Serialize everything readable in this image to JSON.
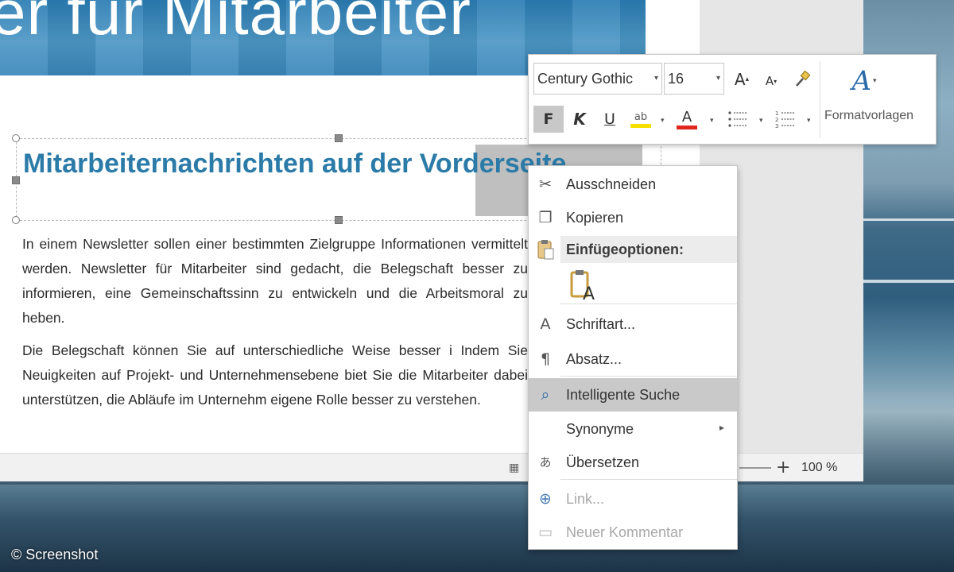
{
  "document": {
    "banner_text": "er für Mitarbeiter",
    "heading": "Mitarbeiternachrichten auf der Vorderseite",
    "paragraphs": [
      "In einem Newsletter sollen einer bestimmten Zielgruppe Informationen vermittelt werden. Newsletter für Mitarbeiter sind gedacht, die Belegschaft besser zu informieren, eine Gemeinschaftssinn zu entwickeln und die Arbeitsmoral zu heben.",
      "Die Belegschaft können Sie auf unterschiedliche Weise besser i Indem Sie Neuigkeiten auf Projekt- und Unternehmensebene biet Sie die Mitarbeiter dabei unterstützen, die Abläufe im Unternehm eigene Rolle besser zu verstehen."
    ]
  },
  "status_bar": {
    "zoom_plus": "+",
    "zoom_level": "100 %"
  },
  "mini_toolbar": {
    "font_name": "Century Gothic",
    "font_size": "16",
    "grow_font": "A",
    "shrink_font": "A",
    "bold": "F",
    "italic": "K",
    "underline": "U",
    "highlight_glyph": "ab",
    "font_color_glyph": "A",
    "styles_label": "Formatvorlagen",
    "styles_glyph": "A"
  },
  "context_menu": {
    "paste_options_header": "Einfügeoptionen:",
    "items": [
      {
        "label": "Ausschneiden",
        "icon": "scissors-icon",
        "glyph": "✂"
      },
      {
        "label": "Kopieren",
        "icon": "copy-icon",
        "glyph": "❐"
      },
      {
        "label": "Schriftart...",
        "icon": "font-icon",
        "glyph": "A"
      },
      {
        "label": "Absatz...",
        "icon": "paragraph-icon",
        "glyph": "¶"
      },
      {
        "label": "Intelligente Suche",
        "icon": "smart-lookup-icon",
        "glyph": "⌕"
      },
      {
        "label": "Synonyme",
        "icon": "",
        "glyph": ""
      },
      {
        "label": "Übersetzen",
        "icon": "translate-icon",
        "glyph": "あ"
      },
      {
        "label": "Link...",
        "icon": "link-icon",
        "glyph": "⊕"
      },
      {
        "label": "Neuer Kommentar",
        "icon": "comment-icon",
        "glyph": "▭"
      }
    ],
    "submenu_arrow": "▸"
  },
  "watermark": "© Screenshot",
  "colors": {
    "heading": "#2b7ba8",
    "highlight_menu": "#c9c9c9",
    "font_color_red": "#e0261c",
    "highlighter_yellow": "#f5e000"
  }
}
